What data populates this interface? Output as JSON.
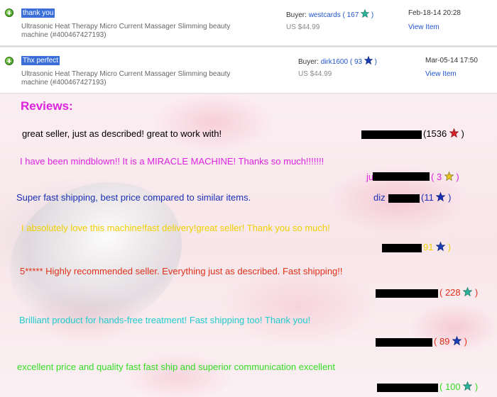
{
  "feedback": [
    {
      "comment": "thank you",
      "item": "Ultrasonic Heat Therapy Micro Current Massager Slimming beauty machine (#400467427193)",
      "buyer_label": "Buyer:",
      "buyer_name": "westcards",
      "buyer_score": "167",
      "star_color": "#2bb39a",
      "price": "US $44.99",
      "date": "Feb-18-14 20:28",
      "view_label": "View Item"
    },
    {
      "comment": "Thx perfect",
      "item": "Ultrasonic Heat Therapy Micro Current Massager Slimming beauty machine (#400467427193)",
      "buyer_label": "Buyer:",
      "buyer_name": "dirk1600",
      "buyer_score": "93",
      "star_color": "#1a3fb5",
      "price": "US $44.99",
      "date": "Mar-05-14 17:50",
      "view_label": "View Item"
    }
  ],
  "reviews": {
    "title": "Reviews:",
    "items": [
      {
        "text": "great seller, just as described! great to work with!",
        "text_color": "#000000",
        "user_suffix": "(1536",
        "score_close": ")",
        "user_color": "#000000",
        "star_color": "#d8232a"
      },
      {
        "text": "I have been mindblown!! It is a MIRACLE MACHINE! Thanks so much!!!!!!!",
        "text_color": "#dd22dd",
        "user_prefix": "ju",
        "user_suffix": "( 3",
        "score_close": ")",
        "user_color": "#dd22dd",
        "star_color": "#e8c820"
      },
      {
        "text": "Super fast shipping, best price compared to similar items.",
        "text_color": "#1a2fb5",
        "user_prefix": "diz",
        "user_suffix": "(11",
        "score_close": ")",
        "user_color": "#1a2fb5",
        "star_color": "#1a2fb5"
      },
      {
        "text": "I absolutely love this machine!fast delivery!great seller! Thank you so much!",
        "text_color": "#f0d000",
        "user_suffix": "91",
        "score_close": ")",
        "user_color": "#f0d000",
        "star_color": "#1a3fb5"
      },
      {
        "text": "5***** Highly recommended seller. Everything just as described. Fast shipping!!",
        "text_color": "#e0301a",
        "user_suffix": "( 228",
        "score_close": ")",
        "user_color": "#e0301a",
        "star_color": "#2bb39a"
      },
      {
        "text": "Brilliant product for hands-free treatment! Fast shipping too! Thank you!",
        "text_color": "#22cccc",
        "user_suffix": "( 89",
        "score_close": ")",
        "user_color": "#e0301a",
        "star_color": "#1a3fb5"
      },
      {
        "text": "excellent price and quality fast fast ship and superior communication excellent",
        "text_color": "#33dd22",
        "user_suffix": "( 100",
        "score_close": ")",
        "user_color": "#33dd22",
        "star_color": "#2bb39a"
      }
    ]
  },
  "colors": {
    "comment_highlight": "#3a6fd8",
    "link": "#2255cc",
    "title": "#dd22dd"
  },
  "icons": {
    "positive_feedback": "plus-circle-icon",
    "rating": "star-icon"
  }
}
